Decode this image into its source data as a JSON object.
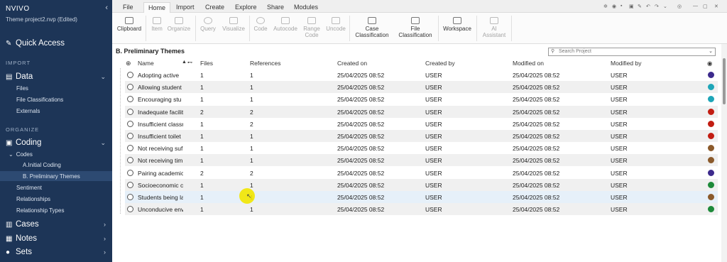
{
  "app": {
    "title": "NVIVO",
    "project": "Theme project2.nvp (Edited)"
  },
  "sidebar": {
    "quick_access": "Quick Access",
    "import_heading": "IMPORT",
    "data": "Data",
    "data_items": [
      "Files",
      "File Classifications",
      "Externals"
    ],
    "organize_heading": "ORGANIZE",
    "coding": "Coding",
    "codes": "Codes",
    "code_items": [
      "A.Initial Coding",
      "B. Preliminary Themes"
    ],
    "coding_items": [
      "Sentiment",
      "Relationships",
      "Relationship Types"
    ],
    "cases": "Cases",
    "notes": "Notes",
    "sets": "Sets"
  },
  "tabs": [
    "File",
    "Home",
    "Import",
    "Create",
    "Explore",
    "Share",
    "Modules"
  ],
  "ribbon": {
    "clipboard": "Clipboard",
    "item": "Item",
    "organize": "Organize",
    "query": "Query",
    "visualize": "Visualize",
    "code": "Code",
    "autocode": "Autocode",
    "range_code_1": "Range",
    "range_code_2": "Code",
    "uncode": "Uncode",
    "case_class_1": "Case",
    "case_class_2": "Classification",
    "file_class_1": "File",
    "file_class_2": "Classification",
    "workspace": "Workspace",
    "ai_1": "AI",
    "ai_2": "Assistant"
  },
  "content": {
    "title": "B. Preliminary Themes",
    "search_placeholder": "Search Project",
    "columns": {
      "name": "Name",
      "files": "Files",
      "references": "References",
      "created_on": "Created on",
      "created_by": "Created by",
      "modified_on": "Modified on",
      "modified_by": "Modified by"
    },
    "rows": [
      {
        "name": "Adopting  active",
        "files": "1",
        "refs": "1",
        "created_on": "25/04/2025 08:52",
        "created_by": "USER",
        "modified_on": "25/04/2025 08:52",
        "modified_by": "USER",
        "color": "#3c2a8c"
      },
      {
        "name": "Allowing student",
        "files": "1",
        "refs": "1",
        "created_on": "25/04/2025 08:52",
        "created_by": "USER",
        "modified_on": "25/04/2025 08:52",
        "modified_by": "USER",
        "color": "#1ea6b8"
      },
      {
        "name": "Encouraging stu",
        "files": "1",
        "refs": "1",
        "created_on": "25/04/2025 08:52",
        "created_by": "USER",
        "modified_on": "25/04/2025 08:52",
        "modified_by": "USER",
        "color": "#1ea6b8"
      },
      {
        "name": "Inadequate facilit",
        "files": "2",
        "refs": "2",
        "created_on": "25/04/2025 08:52",
        "created_by": "USER",
        "modified_on": "25/04/2025 08:52",
        "modified_by": "USER",
        "color": "#c21d12"
      },
      {
        "name": "Insufficient classr",
        "files": "1",
        "refs": "2",
        "created_on": "25/04/2025 08:52",
        "created_by": "USER",
        "modified_on": "25/04/2025 08:52",
        "modified_by": "USER",
        "color": "#c21d12"
      },
      {
        "name": "Insufficient toilet",
        "files": "1",
        "refs": "1",
        "created_on": "25/04/2025 08:52",
        "created_by": "USER",
        "modified_on": "25/04/2025 08:52",
        "modified_by": "USER",
        "color": "#c21d12"
      },
      {
        "name": "Not receiving suf",
        "files": "1",
        "refs": "1",
        "created_on": "25/04/2025 08:52",
        "created_by": "USER",
        "modified_on": "25/04/2025 08:52",
        "modified_by": "USER",
        "color": "#8b5a2b"
      },
      {
        "name": "Not receiving tim",
        "files": "1",
        "refs": "1",
        "created_on": "25/04/2025 08:52",
        "created_by": "USER",
        "modified_on": "25/04/2025 08:52",
        "modified_by": "USER",
        "color": "#8b5a2b"
      },
      {
        "name": "Pairing academic",
        "files": "2",
        "refs": "2",
        "created_on": "25/04/2025 08:52",
        "created_by": "USER",
        "modified_on": "25/04/2025 08:52",
        "modified_by": "USER",
        "color": "#3c2a8c"
      },
      {
        "name": "Socioeconomic c",
        "files": "1",
        "refs": "1",
        "created_on": "25/04/2025 08:52",
        "created_by": "USER",
        "modified_on": "25/04/2025 08:52",
        "modified_by": "USER",
        "color": "#1e8a3a"
      },
      {
        "name": "Students being la",
        "files": "1",
        "refs": "1",
        "created_on": "25/04/2025 08:52",
        "created_by": "USER",
        "modified_on": "25/04/2025 08:52",
        "modified_by": "USER",
        "color": "#8b5a2b"
      },
      {
        "name": "Unconducive env",
        "files": "1",
        "refs": "1",
        "created_on": "25/04/2025 08:52",
        "created_by": "USER",
        "modified_on": "25/04/2025 08:52",
        "modified_by": "USER",
        "color": "#1e8a3a"
      }
    ]
  }
}
